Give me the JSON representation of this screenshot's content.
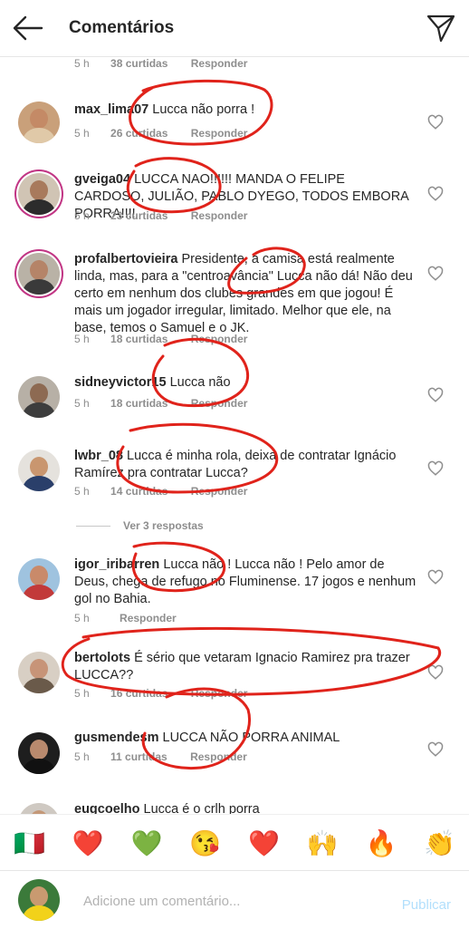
{
  "header": {
    "title": "Comentários"
  },
  "top_meta": {
    "time": "5 h",
    "likes": "38 curtidas",
    "reply": "Responder"
  },
  "comments": [
    {
      "user": "max_lima07",
      "text": "Lucca não porra !",
      "time": "5 h",
      "likes": "26 curtidas",
      "reply": "Responder"
    },
    {
      "user": "gveiga04",
      "text": "LUCCA NAO!!!!!! MANDA O FELIPE CARDOSO, JULIÃO, PABLO DYEGO, TODOS EMBORA PORRA!!!!",
      "time": "5 h",
      "likes": "23 curtidas",
      "reply": "Responder"
    },
    {
      "user": "profalbertovieira",
      "text": "Presidente, a camisa está realmente linda, mas, para a \"centroavância\" Lucca não dá! Não deu certo em nenhum dos clubes grandes em que jogou! É mais um jogador irregular, limitado. Melhor que ele, na base, temos o Samuel e o JK.",
      "time": "5 h",
      "likes": "18 curtidas",
      "reply": "Responder"
    },
    {
      "user": "sidneyvictor15",
      "text": "Lucca não",
      "time": "5 h",
      "likes": "18 curtidas",
      "reply": "Responder"
    },
    {
      "user": "lwbr_08",
      "text": "Lucca é minha rola, deixa de contratar Ignácio Ramírez pra contratar Lucca?",
      "time": "5 h",
      "likes": "14 curtidas",
      "reply": "Responder"
    },
    {
      "user": "igor_iribarren",
      "text": "Lucca não ! Lucca não ! Pelo amor de Deus, chega de refugo no Fluminense. 17 jogos e nenhum gol no Bahia.",
      "time": "5 h",
      "likes": "",
      "reply": "Responder"
    },
    {
      "user": "bertolots",
      "text": "É sério que vetaram Ignacio Ramirez pra trazer LUCCA??",
      "time": "5 h",
      "likes": "16 curtidas",
      "reply": "Responder"
    },
    {
      "user": "gusmendesm",
      "text": "LUCCA NÃO PORRA ANIMAL",
      "time": "5 h",
      "likes": "11 curtidas",
      "reply": "Responder"
    },
    {
      "user": "eugcoelho",
      "text": "Lucca é o crlh porra",
      "time": "",
      "likes": "",
      "reply": ""
    }
  ],
  "view_replies": "Ver 3 respostas",
  "emojis": [
    "🇮🇹",
    "❤️",
    "💚",
    "😘",
    "❤️",
    "🙌",
    "🔥",
    "👏"
  ],
  "composer": {
    "placeholder": "Adicione um comentário...",
    "publish": "Publicar"
  },
  "colors": {
    "annotation": "#e0231b",
    "publish": "#b2dffc",
    "story_ring": "#c13584"
  }
}
